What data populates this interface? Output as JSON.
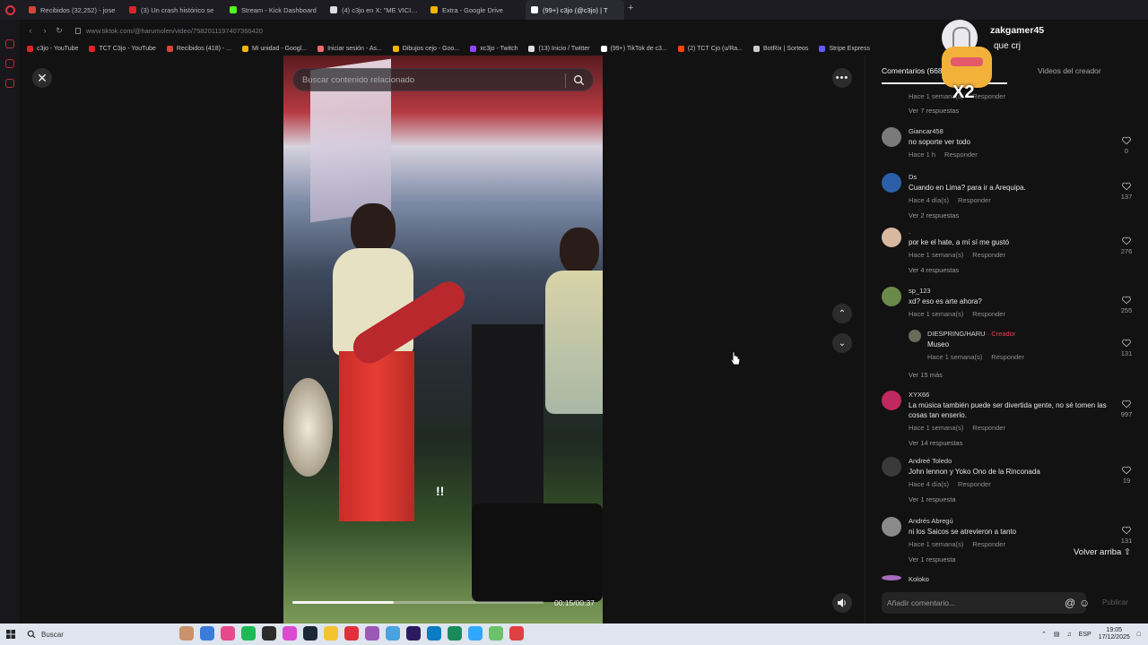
{
  "browser": {
    "tabs": [
      {
        "label": "Recibidos (32,252) - jose",
        "icon_color": "#d44638"
      },
      {
        "label": "(3) Un crash histórico se",
        "icon_color": "#e02424"
      },
      {
        "label": "Stream - Kick Dashboard",
        "icon_color": "#53fc18"
      },
      {
        "label": "(4) c3jo en X: \"ME VICI…",
        "icon_color": "#dddddd"
      },
      {
        "label": "Extra - Google Drive",
        "icon_color": "#f4b400"
      },
      {
        "label": "(99+) c3jo (@c3jo) | T",
        "icon_color": "#ffffff",
        "active": true
      }
    ],
    "url": "www.tiktok.com/@harumolen/video/7582011197407366420",
    "bookmarks": [
      {
        "label": "c3jo - YouTube",
        "color": "#e02424"
      },
      {
        "label": "TCT C3jo - YouTube",
        "color": "#e02424"
      },
      {
        "label": "Recibidos (418) - ...",
        "color": "#d44638"
      },
      {
        "label": "Mi unidad - Googl...",
        "color": "#f4b400"
      },
      {
        "label": "Iniciar sesión - As...",
        "color": "#f06a6a"
      },
      {
        "label": "Dibujos cejo - Goo...",
        "color": "#f4b400"
      },
      {
        "label": "xc3jo - Twitch",
        "color": "#9146ff"
      },
      {
        "label": "(13) Inicio / Twitter",
        "color": "#dddddd"
      },
      {
        "label": "(99+) TikTok de c3...",
        "color": "#ffffff"
      },
      {
        "label": "(2) TCT Cjo (u/Ra...",
        "color": "#ff4500"
      },
      {
        "label": "BotRix | Sorteos",
        "color": "#cccccc"
      },
      {
        "label": "Stripe Express",
        "color": "#635bff"
      }
    ]
  },
  "player": {
    "search_placeholder": "Buscar contenido relacionado",
    "time": "00:15/00:37",
    "progress_fraction": 0.405,
    "exclaim": "!!"
  },
  "stream_overlay": {
    "viewer_name": "zakgamer45",
    "message": "que crj",
    "emote_multiplier": "X2"
  },
  "panel": {
    "tab_comments": "Comentarios (668)",
    "tab_creator": "Videos del creador",
    "top_meta": {
      "time": "Hace 1 semana(s)",
      "reply": "Responder"
    },
    "top_more": "Ver 7 respuestas",
    "comments": [
      {
        "author": "Giancar458",
        "text": "no soporte ver todo",
        "time": "Hace 1 h",
        "reply": "Responder",
        "likes": "0",
        "more": "",
        "avatar": "#7a7a7a"
      },
      {
        "author": "Ds",
        "text": "Cuando en Lima? para ir a Arequipa.",
        "time": "Hace 4 día(s)",
        "reply": "Responder",
        "likes": "137",
        "more": "Ver 2 respuestas",
        "avatar": "#2a5fa8"
      },
      {
        "author": ".",
        "text": "por ke el hate, a mí sí me gustó",
        "time": "Hace 1 semana(s)",
        "reply": "Responder",
        "likes": "276",
        "more": "Ver 4 respuestas",
        "avatar": "#d9b8a0"
      },
      {
        "author": "sp_123",
        "text": "xd? eso es arte ahora?",
        "time": "Hace 1 semana(s)",
        "reply": "Responder",
        "likes": "255",
        "more": "",
        "avatar": "#6b8a4a"
      },
      {
        "author": "XYX66",
        "text": "La música también puede ser divertida gente, no sé tomen las cosas tan enserio.",
        "time": "Hace 1 semana(s)",
        "reply": "Responder",
        "likes": "997",
        "more": "Ver 14 respuestas",
        "avatar": "#c02860"
      },
      {
        "author": "Andreé Toledo",
        "text": "John lennon y Yoko Ono de la Rinconada",
        "time": "Hace 4 día(s)",
        "reply": "Responder",
        "likes": "19",
        "more": "Ver 1 respuesta",
        "avatar": "#3a3a3a"
      },
      {
        "author": "Andrés Abregú",
        "text": "ni los Saicos se atrevieron a tanto",
        "time": "Hace 1 semana(s)",
        "reply": "Responder",
        "likes": "131",
        "more": "Ver 1 respuesta",
        "avatar": "#8a8a8a"
      }
    ],
    "creator_reply": {
      "author": "DIESPRING/HARU",
      "badge": "· Creador",
      "text": "Museo",
      "time": "Hace 1 semana(s)",
      "reply": "Responder",
      "likes": "131",
      "more": "Ver 15 más"
    },
    "next_author": "Koloko",
    "scroll_top": "Volver arriba",
    "input_placeholder": "Añadir comentario...",
    "publish": "Publicar"
  },
  "taskbar": {
    "search": "Buscar",
    "lang": "ESP",
    "time": "19:05",
    "date": "17/12/2025"
  }
}
